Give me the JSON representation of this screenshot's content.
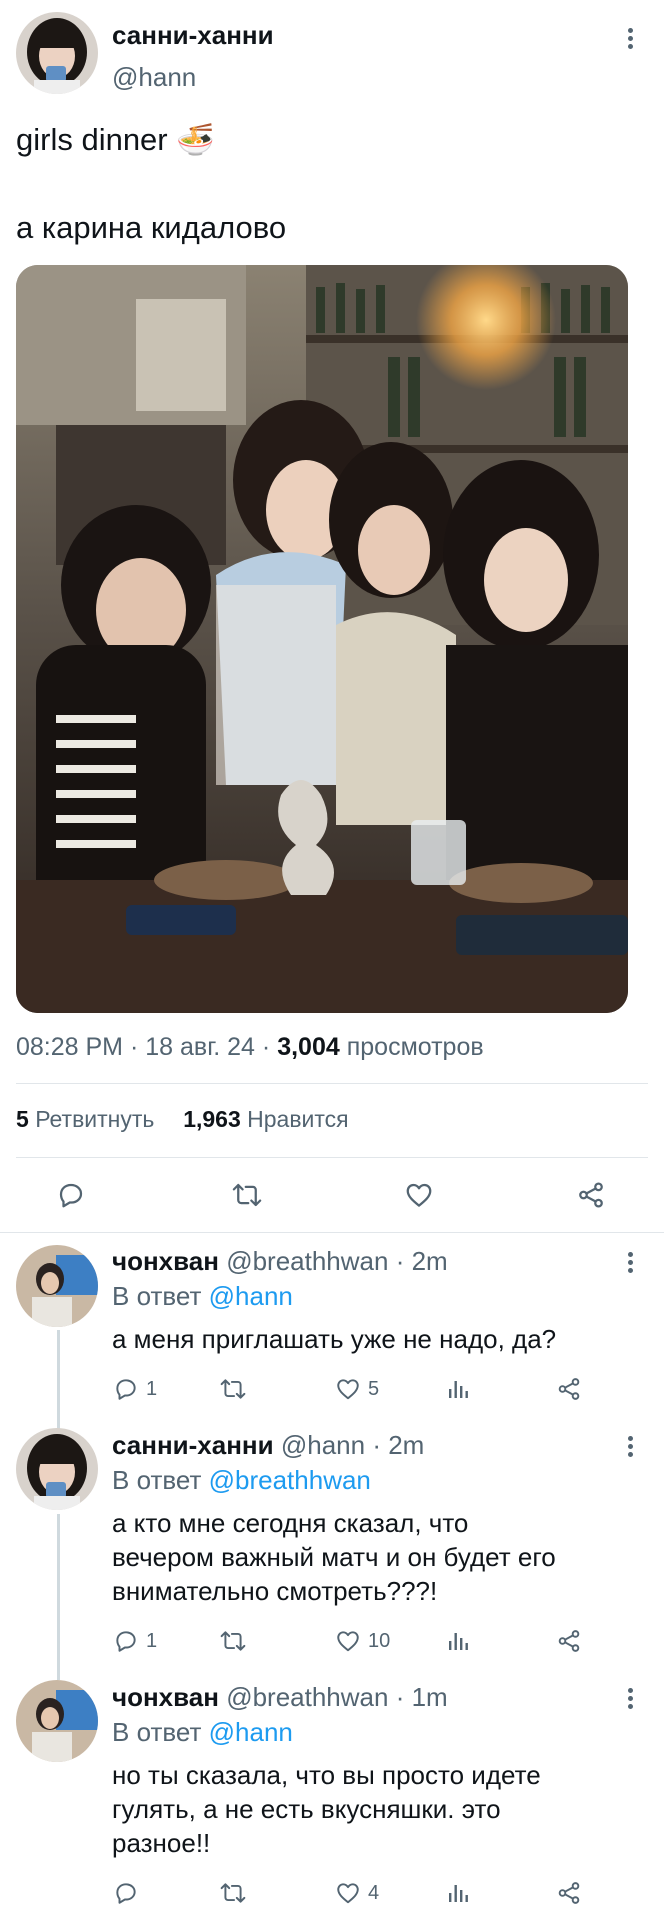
{
  "tweet": {
    "author_name": "санни-ханни",
    "author_handle": "@hann",
    "text_line1": "girls dinner 🍜",
    "text_line2": "а карина кидалово",
    "time": "08:28 PM",
    "date": "18 авг. 24",
    "views_count": "3,004",
    "views_label": "просмотров",
    "retweets_count": "5",
    "retweets_label": "Ретвитнуть",
    "likes_count": "1,963",
    "likes_label": "Нравится",
    "actions": [
      "reply-icon",
      "retweet-icon",
      "like-icon",
      "share-icon"
    ]
  },
  "replies": [
    {
      "name": "чонхван",
      "handle": "@breathhwan",
      "time": "· 2m",
      "reply_prefix": "В ответ",
      "reply_to": "@hann",
      "lines": [
        "а меня приглашать уже не надо, да?"
      ],
      "replies_count": "1",
      "retweets_count": "",
      "likes_count": "5"
    },
    {
      "name": "санни-ханни",
      "handle": "@hann",
      "time": "· 2m",
      "reply_prefix": "В ответ",
      "reply_to": "@breathhwan",
      "lines": [
        "а кто мне сегодня сказал, что",
        "вечером важный матч и он будет его",
        "внимательно смотреть???!"
      ],
      "replies_count": "1",
      "retweets_count": "",
      "likes_count": "10"
    },
    {
      "name": "чонхван",
      "handle": "@breathhwan",
      "time": "· 1m",
      "reply_prefix": "В ответ",
      "reply_to": "@hann",
      "lines": [
        "но ты сказала, что вы просто идете",
        "гулять, а не есть вкусняшки. это",
        "разное!!"
      ],
      "replies_count": "",
      "retweets_count": "",
      "likes_count": "4"
    }
  ],
  "colors": {
    "text": "#0f1419",
    "secondary": "#536471",
    "link": "#1d9bf0",
    "divider": "#e1e6ea"
  }
}
